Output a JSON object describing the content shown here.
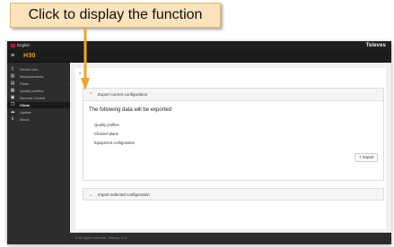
{
  "callout": {
    "text": "Click to display the function"
  },
  "topbar": {
    "language": "English",
    "brand": "Televes"
  },
  "header": {
    "logo": "H30"
  },
  "sidebar": {
    "items": [
      {
        "icon": "device-icon",
        "glyph": "▯",
        "label": "Device info",
        "chevron": ""
      },
      {
        "icon": "measurements-icon",
        "glyph": "▥",
        "label": "Measurements",
        "chevron": "›"
      },
      {
        "icon": "plans-icon",
        "glyph": "▤",
        "label": "Plans",
        "chevron": "›"
      },
      {
        "icon": "quality-icon",
        "glyph": "▦",
        "label": "Quality profiles",
        "chevron": "›"
      },
      {
        "icon": "remote-icon",
        "glyph": "▣",
        "label": "Remote Control",
        "chevron": ""
      },
      {
        "icon": "clone-icon",
        "glyph": "❐",
        "label": "Clone",
        "chevron": ""
      },
      {
        "icon": "update-icon",
        "glyph": "☁",
        "label": "Update",
        "chevron": ""
      },
      {
        "icon": "about-icon",
        "glyph": "ℹ",
        "label": "About",
        "chevron": ""
      }
    ]
  },
  "main": {
    "back": "‹",
    "export_panel": {
      "title": "Export current configuration",
      "lead": "The following data will be exported",
      "items": [
        "Quality profiles",
        "Channel plans",
        "Equipment configuration"
      ],
      "button": "Export"
    },
    "import_panel": {
      "title": "Import selected configuration"
    }
  },
  "footer": {
    "text": "© All rights reserved. Televes, S.A."
  },
  "colors": {
    "accent": "#e8a317",
    "callout_bg": "#fbe3bc",
    "sidebar": "#2d2d2d"
  }
}
